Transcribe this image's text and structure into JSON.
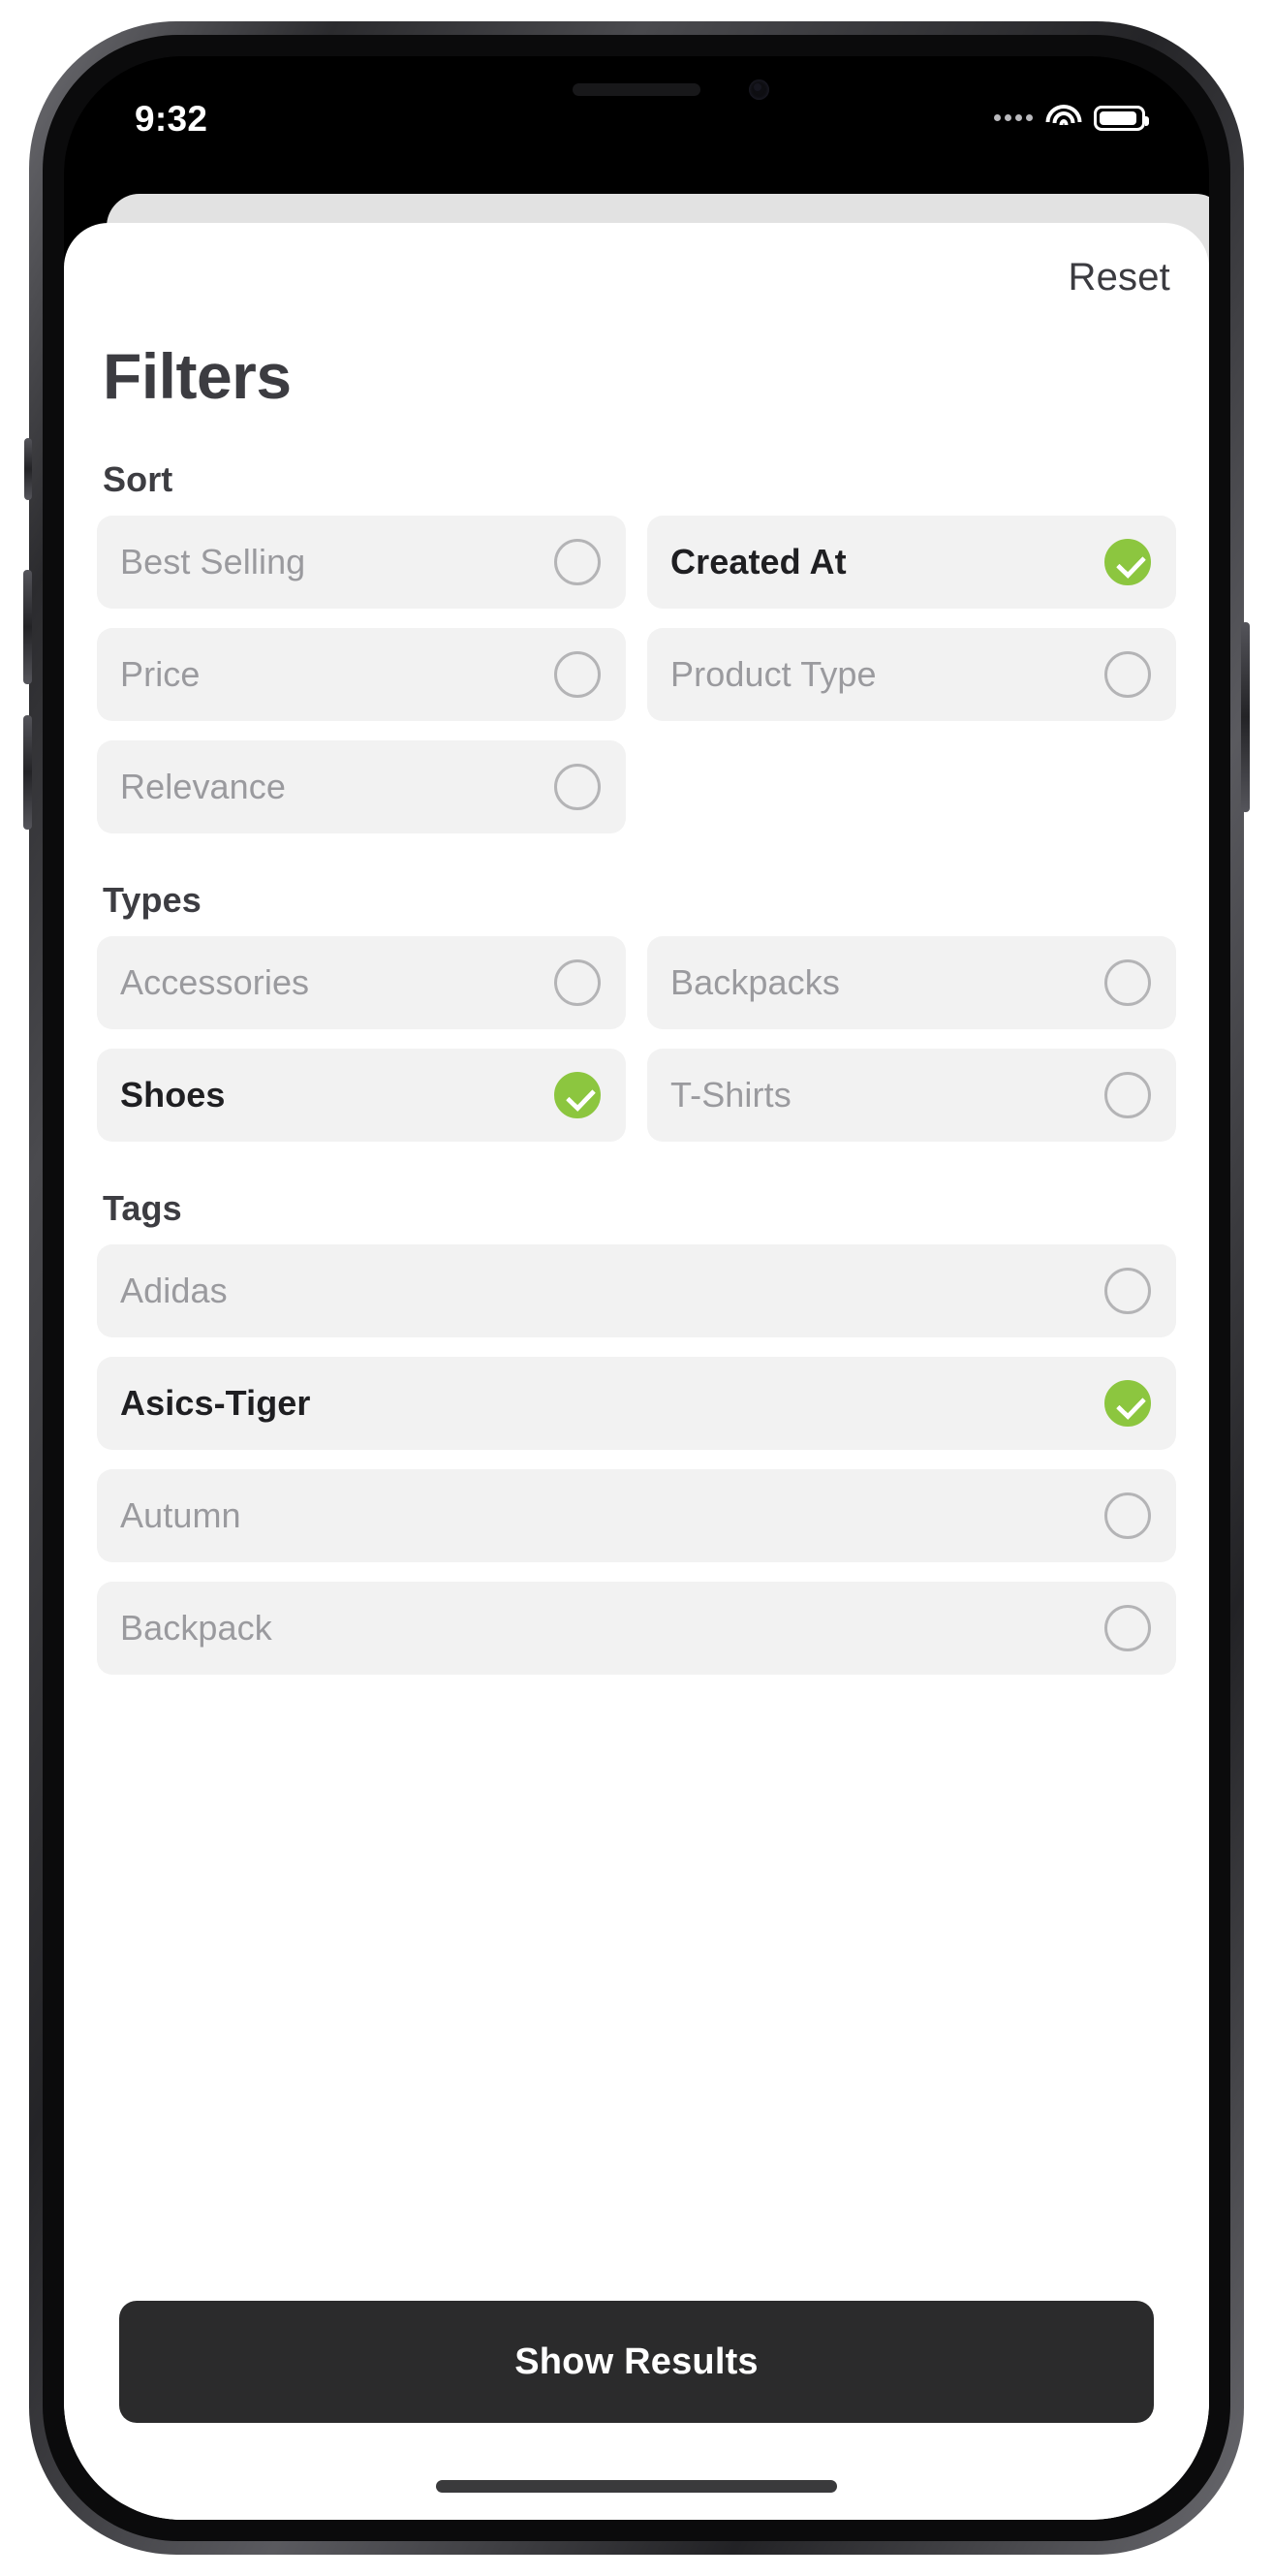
{
  "status_bar": {
    "time": "9:32",
    "signal_icon": "signal-dots-icon",
    "wifi_icon": "wifi-icon",
    "battery_icon": "battery-icon"
  },
  "sheet": {
    "reset_label": "Reset",
    "title": "Filters",
    "submit_label": "Show Results",
    "accent_color": "#8cc63f",
    "chip_bg_color": "#f2f2f2",
    "submit_bg_color": "#2b2b2c"
  },
  "sections": [
    {
      "title": "Sort",
      "layout": "two-column",
      "options": [
        {
          "label": "Best Selling",
          "selected": false
        },
        {
          "label": "Created At",
          "selected": true
        },
        {
          "label": "Price",
          "selected": false
        },
        {
          "label": "Product Type",
          "selected": false
        },
        {
          "label": "Relevance",
          "selected": false
        }
      ]
    },
    {
      "title": "Types",
      "layout": "two-column",
      "options": [
        {
          "label": "Accessories",
          "selected": false
        },
        {
          "label": "Backpacks",
          "selected": false
        },
        {
          "label": "Shoes",
          "selected": true
        },
        {
          "label": "T-Shirts",
          "selected": false
        }
      ]
    },
    {
      "title": "Tags",
      "layout": "one-column",
      "options": [
        {
          "label": "Adidas",
          "selected": false
        },
        {
          "label": "Asics-Tiger",
          "selected": true
        },
        {
          "label": "Autumn",
          "selected": false
        },
        {
          "label": "Backpack",
          "selected": false
        }
      ]
    }
  ]
}
